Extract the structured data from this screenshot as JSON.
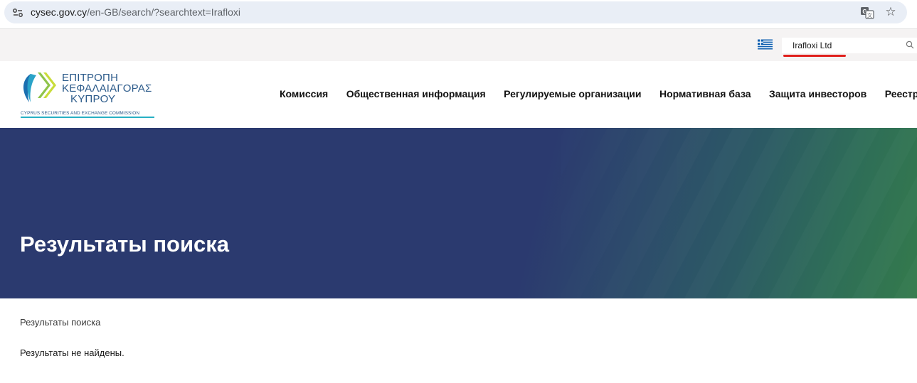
{
  "browser": {
    "url_host": "cysec.gov.cy",
    "url_path": "/en-GB/search/?searchtext=Irafloxi",
    "icons": [
      "site-info-icon",
      "translate-icon",
      "star-icon"
    ]
  },
  "utility": {
    "search_value": "Irafloxi Ltd",
    "language_flag": "greek-flag-icon"
  },
  "logo": {
    "line1": "ΕΠΙΤΡΟΠΗ",
    "line2": "ΚΕΦΑΛΑΙΑΓΟΡΑΣ",
    "line3": "ΚΥΠΡΟΥ",
    "subtitle": "CYPRUS SECURITIES AND EXCHANGE COMMISSION"
  },
  "nav": {
    "items": [
      {
        "label": "Комиссия"
      },
      {
        "label": "Общественная информация"
      },
      {
        "label": "Регулируемые организации"
      },
      {
        "label": "Нормативная база"
      },
      {
        "label": "Защита инвесторов"
      },
      {
        "label": "Реестры и порт"
      }
    ]
  },
  "hero": {
    "title": "Результаты поиска"
  },
  "content": {
    "breadcrumb": "Результаты поиска",
    "message": "Результаты не найдены."
  },
  "colors": {
    "hero_blue": "#2b3a6f",
    "hero_green": "#347a4c",
    "annotation_red": "#e0201c",
    "brand_blue": "#2b5a8a"
  }
}
